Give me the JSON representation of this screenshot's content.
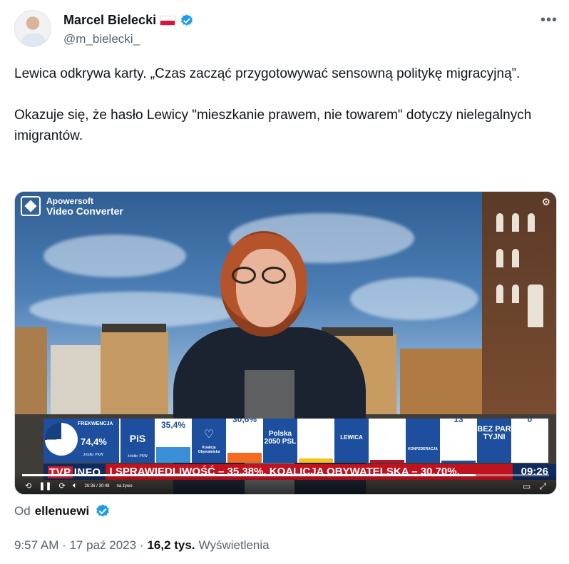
{
  "author": {
    "name": "Marcel Bielecki",
    "handle": "@m_bielecki_"
  },
  "more_label": "•••",
  "tweet": {
    "paragraph1": "Lewica odkrywa karty. „Czas zacząć  przygotowywać sensowną politykę migracyjną”.",
    "paragraph2": "Okazuje się, że hasło Lewicy \"mieszkanie prawem, nie towarem\" dotyczy nielegalnych imigrantów."
  },
  "video": {
    "watermark_line1": "Apowersoft",
    "watermark_line2": "Video Converter",
    "turnout_label": "FREKWENCJA",
    "turnout_value": "74,4%",
    "turnout_fraction": 0.744,
    "source_label": "źródło: PKW",
    "party_pis": "PiS",
    "bar1_value": "35,4%",
    "bar2_value": "30,6%",
    "logo_ko": "Koalicja Obywatelska",
    "logo_psl": "Polska 2050 PSL",
    "logo_lewica": "LEWICA",
    "logo_konf": "KONFEDERACJA",
    "bar_konf_value": "13",
    "logo_bez": "BEZ PAR TYJNI",
    "bar_bez_value": "0",
    "tvp_label": "TVP",
    "info_label": "INFO",
    "ticker": "I SPRAWIEDLIWOŚĆ – 35,38%,  KOALICJA OBYWATELSKA – 30,70%,",
    "clock": "09:26",
    "playback_time": "26:36 / 30:48",
    "progress_fraction": 0.86,
    "live_label": "na żywo"
  },
  "from": {
    "prefix": "Od",
    "user": "ellenuewi"
  },
  "meta": {
    "time": "9:57 AM · 17 paź 2023 ·",
    "views_count": "16,2 tys.",
    "views_label": "Wyświetlenia"
  },
  "colors": {
    "verified": "#1d9bf0",
    "muted_text": "#536471",
    "tvp_blue": "#1d4f9e",
    "ticker_red": "#c1121f"
  }
}
